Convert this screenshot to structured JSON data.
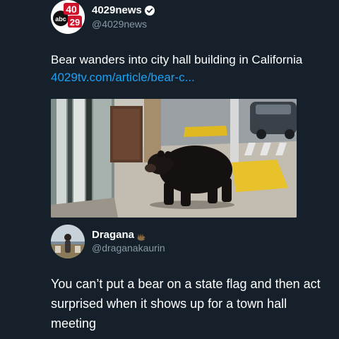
{
  "tweet": {
    "author": {
      "display_name": "4029news",
      "handle": "@4029news",
      "verified": true,
      "avatar_icon": "abc-40-29-logo-icon",
      "avatar_logo_text": "40 abc 29"
    },
    "text_main": "Bear wanders into city hall building in California ",
    "text_link": "4029tv.com/article/bear-c...",
    "link_color": "#1da1f2",
    "photo_icon": "bear-photo"
  },
  "reply": {
    "author": {
      "display_name": "Dragana",
      "handle": "@draganakaurin",
      "name_emoji_icon": "hedgehog-icon",
      "avatar_icon": "user-avatar-photo"
    },
    "text": "You can’t put a bear on a state flag and then act surprised when it shows up for a town hall meeting"
  },
  "theme": {
    "background": "#15202b",
    "secondary_text": "#8899a6"
  }
}
